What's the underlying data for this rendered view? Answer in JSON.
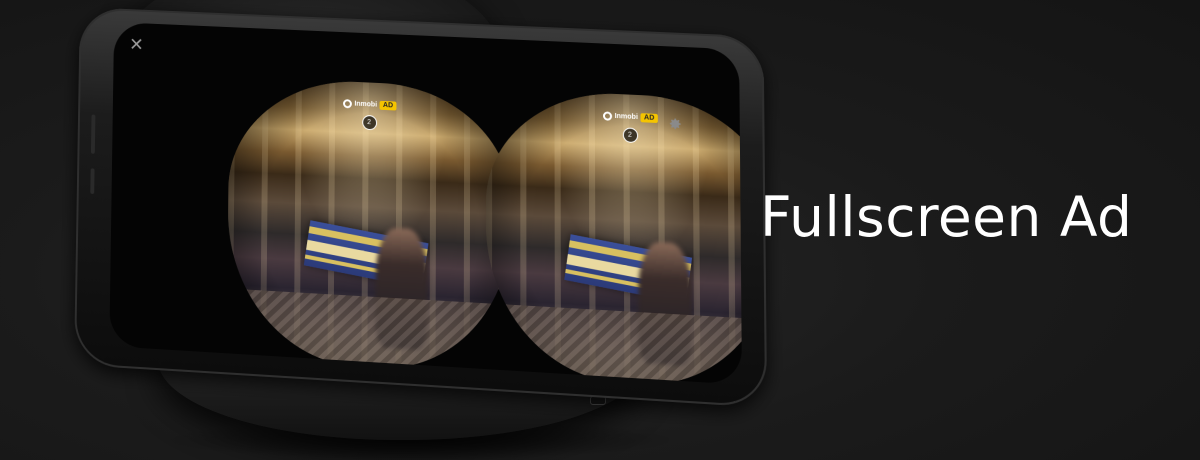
{
  "headline": "Fullscreen Ad",
  "ad_overlay": {
    "brand": "Inmobi",
    "badge": "AD",
    "counter": "2"
  },
  "icons": {
    "close": "close-icon",
    "settings": "gear-icon"
  },
  "colors": {
    "background": "#1a1a1a",
    "headline": "#ffffff",
    "ad_badge": "#f5c400"
  }
}
